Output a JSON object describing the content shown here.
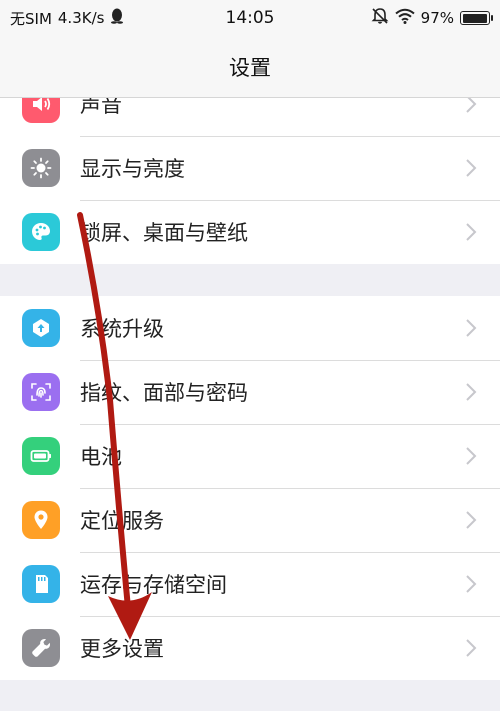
{
  "status": {
    "carrier": "无SIM",
    "speed": "4.3K/s",
    "time": "14:05",
    "battery": "97%",
    "battery_level": 0.97,
    "icons": [
      "qq-penguin-icon",
      "alarm-off-icon",
      "wifi-icon",
      "battery-icon"
    ]
  },
  "header": {
    "title": "设置"
  },
  "groups": [
    {
      "items": [
        {
          "label": "声音",
          "icon": "speaker-icon",
          "color": "#ff5a6e"
        },
        {
          "label": "显示与亮度",
          "icon": "brightness-icon",
          "color": "#8e8e93"
        },
        {
          "label": "锁屏、桌面与壁纸",
          "icon": "palette-icon",
          "color": "#2bc9d8"
        }
      ]
    },
    {
      "items": [
        {
          "label": "系统升级",
          "icon": "update-icon",
          "color": "#34b3e8"
        },
        {
          "label": "指纹、面部与密码",
          "icon": "fingerprint-icon",
          "color": "#9b6ff0"
        },
        {
          "label": "电池",
          "icon": "battery-icon",
          "color": "#34d07c"
        },
        {
          "label": "定位服务",
          "icon": "location-icon",
          "color": "#ffa026"
        },
        {
          "label": "运存与存储空间",
          "icon": "storage-icon",
          "color": "#34b3e8"
        },
        {
          "label": "更多设置",
          "icon": "wrench-icon",
          "color": "#8e8e93"
        }
      ]
    }
  ],
  "annotation": {
    "type": "arrow",
    "color": "#b01a12"
  }
}
